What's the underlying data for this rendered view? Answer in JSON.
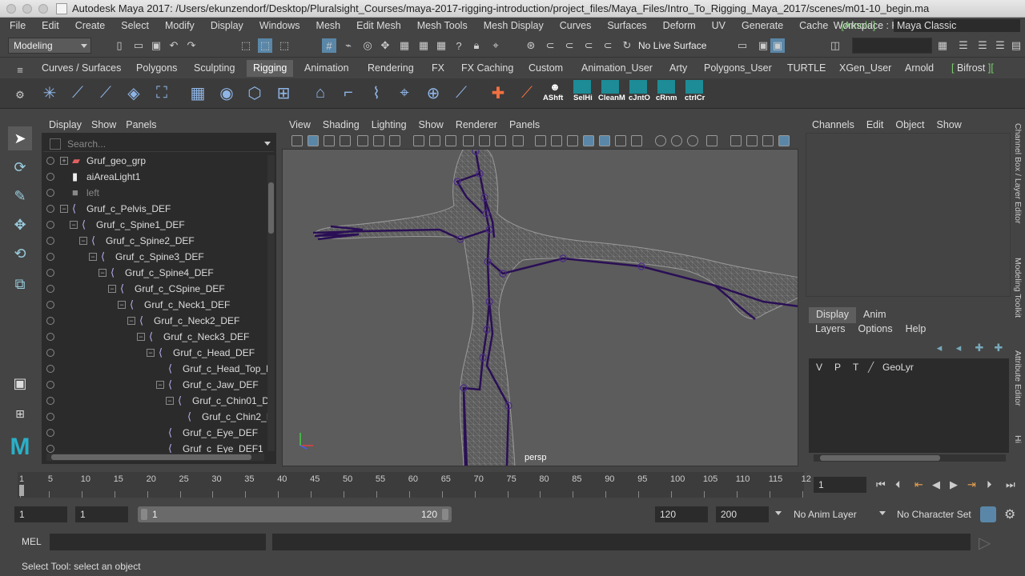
{
  "window": {
    "title": "Autodesk Maya 2017: /Users/ekunzendorf/Desktop/Pluralsight_Courses/maya-2017-rigging-introduction/project_files/Maya_Files/Intro_To_Rigging_Maya_2017/scenes/m01-10_begin.ma"
  },
  "menubar": {
    "items": [
      "File",
      "Edit",
      "Create",
      "Select",
      "Modify",
      "Display",
      "Windows",
      "Mesh",
      "Edit Mesh",
      "Mesh Tools",
      "Mesh Display",
      "Curves",
      "Surfaces",
      "Deform",
      "UV",
      "Generate",
      "Cache",
      "Arnold",
      "Help"
    ],
    "workspace_label": "Workspace :",
    "workspace_value": "Maya Classic"
  },
  "statusline": {
    "mode": "Modeling",
    "live_surface": "No Live Surface"
  },
  "shelf_tabs": [
    "Curves / Surfaces",
    "Polygons",
    "Sculpting",
    "Rigging",
    "Animation",
    "Rendering",
    "FX",
    "FX Caching",
    "Custom",
    "Animation_User",
    "Arty",
    "Polygons_User",
    "TURTLE",
    "XGen_User",
    "Arnold",
    "Bifrost"
  ],
  "active_shelf_tab": "Rigging",
  "shelf_custom_labels": [
    "AShft",
    "SelHi",
    "CleanM",
    "cJntO",
    "cRnm",
    "ctrlCr"
  ],
  "outliner": {
    "menu": [
      "Display",
      "Show",
      "Panels"
    ],
    "search_placeholder": "Search...",
    "items": [
      {
        "label": "Gruf_geo_grp",
        "depth": 0,
        "type": "group"
      },
      {
        "label": "aiAreaLight1",
        "depth": 0,
        "type": "light"
      },
      {
        "label": "left",
        "depth": 0,
        "type": "camera"
      },
      {
        "label": "Gruf_c_Pelvis_DEF",
        "depth": 0,
        "type": "joint"
      },
      {
        "label": "Gruf_c_Spine1_DEF",
        "depth": 1,
        "type": "joint"
      },
      {
        "label": "Gruf_c_Spine2_DEF",
        "depth": 2,
        "type": "joint"
      },
      {
        "label": "Gruf_c_Spine3_DEF",
        "depth": 3,
        "type": "joint"
      },
      {
        "label": "Gruf_c_Spine4_DEF",
        "depth": 4,
        "type": "joint"
      },
      {
        "label": "Gruf_c_CSpine_DEF",
        "depth": 5,
        "type": "joint"
      },
      {
        "label": "Gruf_c_Neck1_DEF",
        "depth": 6,
        "type": "joint"
      },
      {
        "label": "Gruf_c_Neck2_DEF",
        "depth": 7,
        "type": "joint"
      },
      {
        "label": "Gruf_c_Neck3_DEF",
        "depth": 8,
        "type": "joint"
      },
      {
        "label": "Gruf_c_Head_DEF",
        "depth": 9,
        "type": "joint"
      },
      {
        "label": "Gruf_c_Head_Top_D",
        "depth": 10,
        "type": "joint"
      },
      {
        "label": "Gruf_c_Jaw_DEF",
        "depth": 10,
        "type": "joint"
      },
      {
        "label": "Gruf_c_Chin01_D",
        "depth": 11,
        "type": "joint"
      },
      {
        "label": "Gruf_c_Chin2_I",
        "depth": 12,
        "type": "joint"
      },
      {
        "label": "Gruf_c_Eye_DEF",
        "depth": 10,
        "type": "joint"
      },
      {
        "label": "Gruf_c_Eye_DEF1",
        "depth": 10,
        "type": "joint"
      }
    ]
  },
  "viewport": {
    "menu": [
      "View",
      "Shading",
      "Lighting",
      "Show",
      "Renderer",
      "Panels"
    ],
    "camera_label": "persp"
  },
  "channel_box": {
    "menu": [
      "Channels",
      "Edit",
      "Object",
      "Show"
    ]
  },
  "layer_editor": {
    "tabs": [
      "Display",
      "Anim"
    ],
    "active_tab": "Display",
    "menu": [
      "Layers",
      "Options",
      "Help"
    ],
    "columns": [
      "V",
      "P",
      "T"
    ],
    "layer_name": "GeoLyr"
  },
  "side_tabs": [
    "Channel Box / Layer Editor",
    "Modeling Toolkit",
    "Attribute Editor",
    "Hi"
  ],
  "time_slider": {
    "ticks": [
      "1",
      "5",
      "10",
      "15",
      "20",
      "25",
      "30",
      "35",
      "40",
      "45",
      "50",
      "55",
      "60",
      "65",
      "70",
      "75",
      "80",
      "85",
      "90",
      "95",
      "100",
      "105",
      "110",
      "115",
      "12"
    ],
    "current_frame": "1"
  },
  "range": {
    "start": "1",
    "inner_start": "1",
    "slider_start": "1",
    "slider_end": "120",
    "end": "120",
    "total_end": "200",
    "anim_layer": "No Anim Layer",
    "character_set": "No Character Set"
  },
  "command_line": {
    "label": "MEL"
  },
  "help_line": {
    "text": "Select Tool: select an object"
  }
}
